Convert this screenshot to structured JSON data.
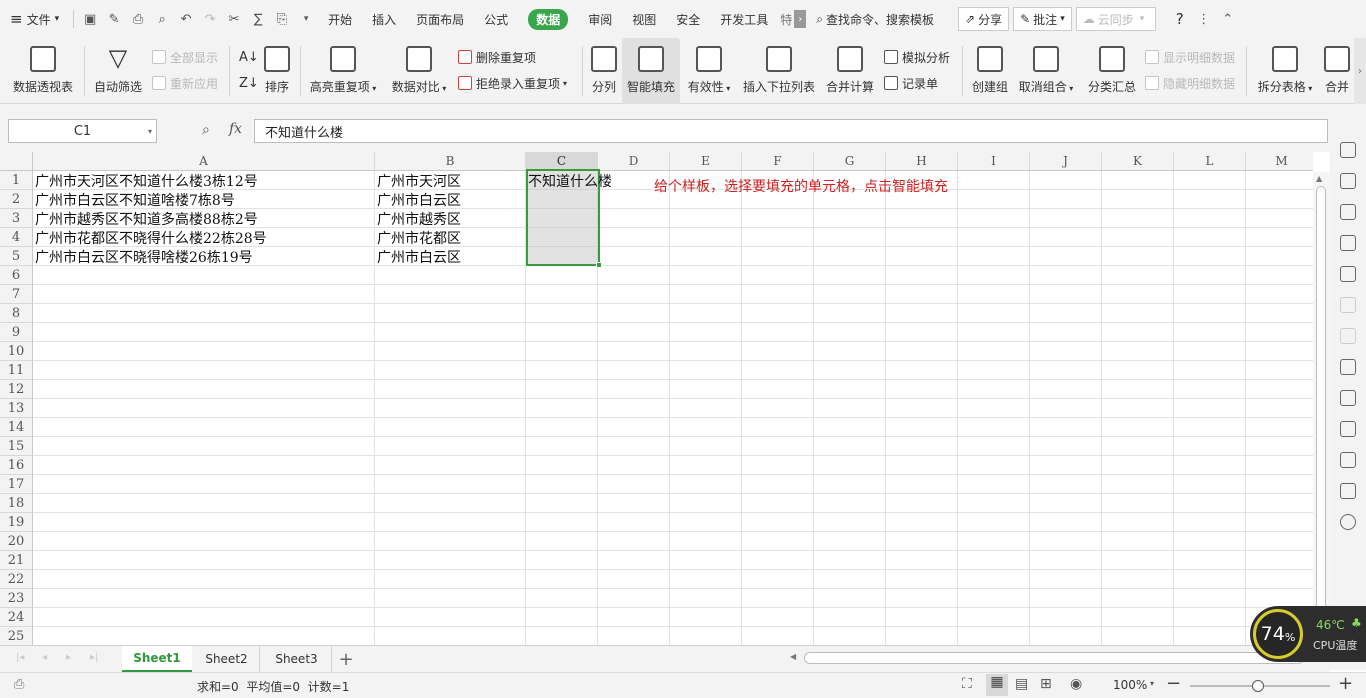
{
  "menu": {
    "file": "文件",
    "tabs": [
      "开始",
      "插入",
      "页面布局",
      "公式",
      "数据",
      "审阅",
      "视图",
      "安全",
      "开发工具",
      "特"
    ],
    "active_tab": "数据",
    "search": "查找命令、搜索模板",
    "share": "分享",
    "review": "批注",
    "cloud_sync": "云同步",
    "help": "?"
  },
  "ribbon": {
    "pivot": "数据透视表",
    "autofilter": "自动筛选",
    "show_all": "全部显示",
    "reapply": "重新应用",
    "sort": "排序",
    "highlight_dup": "高亮重复项",
    "compare": "数据对比",
    "remove_dup": "删除重复项",
    "reject_dup": "拒绝录入重复项",
    "split": "分列",
    "smart_fill": "智能填充",
    "validity": "有效性",
    "insert_dropdown": "插入下拉列表",
    "consolidate": "合并计算",
    "what_if": "模拟分析",
    "record_sheet": "记录单",
    "create_group": "创建组",
    "ungroup": "取消组合",
    "subtotal": "分类汇总",
    "show_detail": "显示明细数据",
    "hide_detail": "隐藏明细数据",
    "split_table": "拆分表格",
    "merge": "合并"
  },
  "formula": {
    "cell_ref": "C1",
    "fx": "fx",
    "value": "不知道什么楼"
  },
  "sheet": {
    "columns": [
      "A",
      "B",
      "C",
      "D",
      "E",
      "F",
      "G",
      "H",
      "I",
      "J",
      "K",
      "L",
      "M"
    ],
    "rows": [
      "1",
      "2",
      "3",
      "4",
      "5",
      "6",
      "7",
      "8",
      "9",
      "10",
      "11",
      "12",
      "13",
      "14",
      "15",
      "16",
      "17",
      "18",
      "19",
      "20",
      "21",
      "22",
      "23",
      "24",
      "25"
    ],
    "colA": [
      "广州市天河区不知道什么楼3栋12号",
      "广州市白云区不知道啥楼7栋8号",
      "广州市越秀区不知道多高楼88栋2号",
      "广州市花都区不晓得什么楼22栋28号",
      "广州市白云区不晓得啥楼26栋19号"
    ],
    "colB": [
      "广州市天河区",
      "广州市白云区",
      "广州市越秀区",
      "广州市花都区",
      "广州市白云区"
    ],
    "colC": [
      "不知道什么楼"
    ],
    "note": "给个样板，选择要填充的单元格，点击智能填充"
  },
  "tabs": [
    "Sheet1",
    "Sheet2",
    "Sheet3"
  ],
  "active_sheet": "Sheet1",
  "add_sheet": "+",
  "status": {
    "summary": "求和=0  平均值=0  计数=1",
    "zoom": "100%"
  },
  "cpu": {
    "percent": "74",
    "unit": "%",
    "temp": "46℃",
    "label": "CPU温度"
  }
}
